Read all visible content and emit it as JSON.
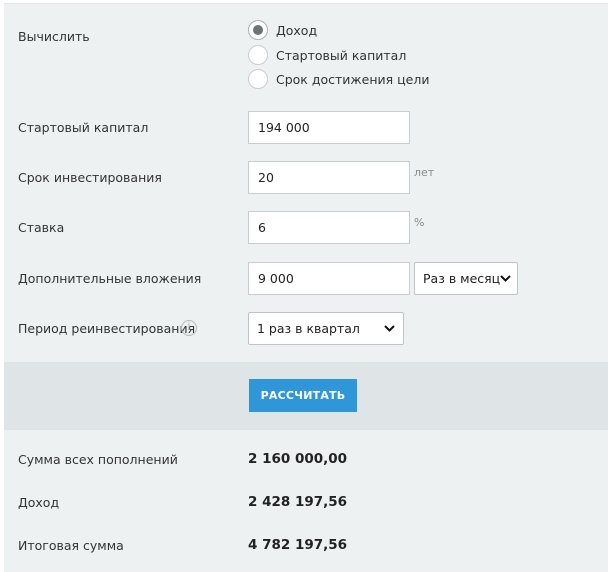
{
  "calculate": {
    "label": "Вычислить",
    "options": [
      {
        "label": "Доход",
        "checked": true
      },
      {
        "label": "Стартовый капитал",
        "checked": false
      },
      {
        "label": "Срок достижения цели",
        "checked": false
      }
    ]
  },
  "fields": {
    "starting_capital": {
      "label": "Стартовый капитал",
      "value": "194 000"
    },
    "term": {
      "label": "Срок инвестирования",
      "value": "20",
      "unit": "лет"
    },
    "rate": {
      "label": "Ставка",
      "value": "6",
      "unit": "%"
    },
    "additional": {
      "label": "Дополнительные вложения",
      "value": "9 000",
      "frequency": "Раз в месяц"
    },
    "reinvest": {
      "label": "Период реинвестирования",
      "value": "1 раз в квартал",
      "info_icon": "info-icon"
    }
  },
  "button": {
    "label": "РАССЧИТАТЬ"
  },
  "results": [
    {
      "label": "Сумма всех пополнений",
      "value": "2 160 000,00"
    },
    {
      "label": "Доход",
      "value": "2 428 197,56"
    },
    {
      "label": "Итоговая сумма",
      "value": "4 782 197,56"
    }
  ],
  "colors": {
    "panel": "#eef1f2",
    "button_panel": "#dfe4e7",
    "button": "#2f97d8",
    "radio_dot": "#6d7479"
  }
}
